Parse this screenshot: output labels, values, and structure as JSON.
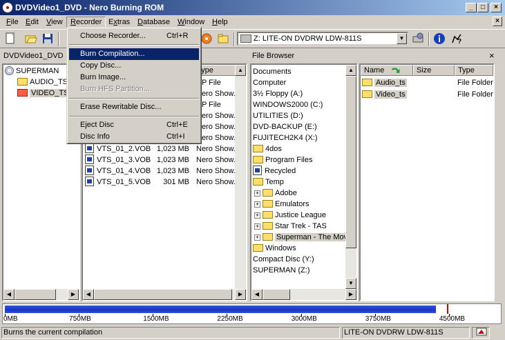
{
  "window": {
    "title": "DVDVideo1_DVD - Nero Burning ROM"
  },
  "menubar": [
    "File",
    "Edit",
    "View",
    "Recorder",
    "Extras",
    "Database",
    "Window",
    "Help"
  ],
  "toolbar": {
    "drive": "Z: LITE-ON  DVDRW LDW-811S"
  },
  "compilation": {
    "header": "DVDVideo1_DVD",
    "tree": {
      "root": "SUPERMAN",
      "children": [
        "AUDIO_TS",
        "VIDEO_TS"
      ]
    },
    "column_type": "Type",
    "files": [
      {
        "name": "",
        "size": "",
        "type": "UP File"
      },
      {
        "name": "",
        "size": "",
        "type": "Nero Show..."
      },
      {
        "name": "",
        "size": "",
        "type": "UP File"
      },
      {
        "name": "",
        "size": "",
        "type": "Nero Show..."
      },
      {
        "name": "",
        "size": "",
        "type": "Nero Show..."
      },
      {
        "name": "",
        "size": "",
        "type": "Nero Show..."
      },
      {
        "name": "VTS_01_2.VOB",
        "size": "1,023 MB",
        "type": "Nero Show..."
      },
      {
        "name": "VTS_01_3.VOB",
        "size": "1,023 MB",
        "type": "Nero Show..."
      },
      {
        "name": "VTS_01_4.VOB",
        "size": "1,023 MB",
        "type": "Nero Show..."
      },
      {
        "name": "VTS_01_5.VOB",
        "size": "301 MB",
        "type": "Nero Show..."
      }
    ]
  },
  "recorder_menu": {
    "items": [
      {
        "label": "Choose Recorder...",
        "accel": "Ctrl+R"
      },
      {
        "label": "Burn Compilation...",
        "accel": ""
      },
      {
        "label": "Copy Disc...",
        "accel": ""
      },
      {
        "label": "Burn Image...",
        "accel": ""
      },
      {
        "label": "Burn HFS Partition...",
        "accel": ""
      },
      {
        "label": "Erase Rewritable Disc...",
        "accel": ""
      },
      {
        "label": "Eject Disc",
        "accel": "Ctrl+E"
      },
      {
        "label": "Disc Info",
        "accel": "Ctrl+I"
      }
    ]
  },
  "file_browser": {
    "header": "File Browser",
    "close": "×",
    "tree": [
      "Documents",
      "Computer",
      "3½ Floppy (A:)",
      "WINDOWS2000 (C:)",
      "UTILITIES (D:)",
      "DVD-BACKUP (E:)",
      "FUJITECH2K4 (X:)",
      "4dos",
      "Program Files",
      "Recycled",
      "Temp",
      "Adobe",
      "Emulators",
      "Justice League",
      "Star Trek - TAS",
      "Superman - The Movie",
      "Windows",
      "Compact Disc (Y:)",
      "SUPERMAN (Z:)"
    ],
    "columns": [
      "Name",
      "Size",
      "Type"
    ],
    "items": [
      {
        "name": "Audio_ts",
        "size": "",
        "type": "File Folder"
      },
      {
        "name": "Video_ts",
        "size": "",
        "type": "File Folder"
      }
    ]
  },
  "capacity": {
    "ticks": [
      "0MB",
      "750MB",
      "1500MB",
      "2250MB",
      "3000MB",
      "3750MB",
      "4500MB"
    ],
    "used_mb": 4370,
    "limit_mb": 4480,
    "scale_max_mb": 4900
  },
  "statusbar": {
    "message": "Burns the current compilation",
    "drive": "LITE-ON  DVDRW LDW-811S"
  },
  "colors": {
    "titlebar": "#0a246a",
    "highlight": "#0a246a",
    "capacity_fill": "#1838c0",
    "capacity_limit": "#d00000"
  }
}
